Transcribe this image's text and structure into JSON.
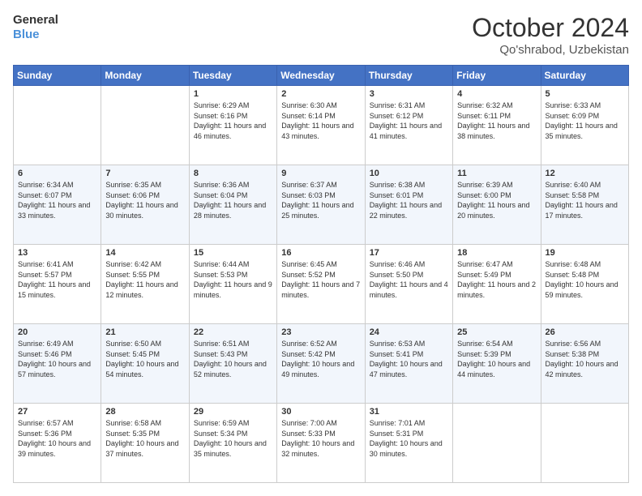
{
  "header": {
    "logo_general": "General",
    "logo_blue": "Blue",
    "month": "October 2024",
    "location": "Qo'shrabod, Uzbekistan"
  },
  "weekdays": [
    "Sunday",
    "Monday",
    "Tuesday",
    "Wednesday",
    "Thursday",
    "Friday",
    "Saturday"
  ],
  "weeks": [
    [
      {
        "day": "",
        "sunrise": "",
        "sunset": "",
        "daylight": ""
      },
      {
        "day": "",
        "sunrise": "",
        "sunset": "",
        "daylight": ""
      },
      {
        "day": "1",
        "sunrise": "Sunrise: 6:29 AM",
        "sunset": "Sunset: 6:16 PM",
        "daylight": "Daylight: 11 hours and 46 minutes."
      },
      {
        "day": "2",
        "sunrise": "Sunrise: 6:30 AM",
        "sunset": "Sunset: 6:14 PM",
        "daylight": "Daylight: 11 hours and 43 minutes."
      },
      {
        "day": "3",
        "sunrise": "Sunrise: 6:31 AM",
        "sunset": "Sunset: 6:12 PM",
        "daylight": "Daylight: 11 hours and 41 minutes."
      },
      {
        "day": "4",
        "sunrise": "Sunrise: 6:32 AM",
        "sunset": "Sunset: 6:11 PM",
        "daylight": "Daylight: 11 hours and 38 minutes."
      },
      {
        "day": "5",
        "sunrise": "Sunrise: 6:33 AM",
        "sunset": "Sunset: 6:09 PM",
        "daylight": "Daylight: 11 hours and 35 minutes."
      }
    ],
    [
      {
        "day": "6",
        "sunrise": "Sunrise: 6:34 AM",
        "sunset": "Sunset: 6:07 PM",
        "daylight": "Daylight: 11 hours and 33 minutes."
      },
      {
        "day": "7",
        "sunrise": "Sunrise: 6:35 AM",
        "sunset": "Sunset: 6:06 PM",
        "daylight": "Daylight: 11 hours and 30 minutes."
      },
      {
        "day": "8",
        "sunrise": "Sunrise: 6:36 AM",
        "sunset": "Sunset: 6:04 PM",
        "daylight": "Daylight: 11 hours and 28 minutes."
      },
      {
        "day": "9",
        "sunrise": "Sunrise: 6:37 AM",
        "sunset": "Sunset: 6:03 PM",
        "daylight": "Daylight: 11 hours and 25 minutes."
      },
      {
        "day": "10",
        "sunrise": "Sunrise: 6:38 AM",
        "sunset": "Sunset: 6:01 PM",
        "daylight": "Daylight: 11 hours and 22 minutes."
      },
      {
        "day": "11",
        "sunrise": "Sunrise: 6:39 AM",
        "sunset": "Sunset: 6:00 PM",
        "daylight": "Daylight: 11 hours and 20 minutes."
      },
      {
        "day": "12",
        "sunrise": "Sunrise: 6:40 AM",
        "sunset": "Sunset: 5:58 PM",
        "daylight": "Daylight: 11 hours and 17 minutes."
      }
    ],
    [
      {
        "day": "13",
        "sunrise": "Sunrise: 6:41 AM",
        "sunset": "Sunset: 5:57 PM",
        "daylight": "Daylight: 11 hours and 15 minutes."
      },
      {
        "day": "14",
        "sunrise": "Sunrise: 6:42 AM",
        "sunset": "Sunset: 5:55 PM",
        "daylight": "Daylight: 11 hours and 12 minutes."
      },
      {
        "day": "15",
        "sunrise": "Sunrise: 6:44 AM",
        "sunset": "Sunset: 5:53 PM",
        "daylight": "Daylight: 11 hours and 9 minutes."
      },
      {
        "day": "16",
        "sunrise": "Sunrise: 6:45 AM",
        "sunset": "Sunset: 5:52 PM",
        "daylight": "Daylight: 11 hours and 7 minutes."
      },
      {
        "day": "17",
        "sunrise": "Sunrise: 6:46 AM",
        "sunset": "Sunset: 5:50 PM",
        "daylight": "Daylight: 11 hours and 4 minutes."
      },
      {
        "day": "18",
        "sunrise": "Sunrise: 6:47 AM",
        "sunset": "Sunset: 5:49 PM",
        "daylight": "Daylight: 11 hours and 2 minutes."
      },
      {
        "day": "19",
        "sunrise": "Sunrise: 6:48 AM",
        "sunset": "Sunset: 5:48 PM",
        "daylight": "Daylight: 10 hours and 59 minutes."
      }
    ],
    [
      {
        "day": "20",
        "sunrise": "Sunrise: 6:49 AM",
        "sunset": "Sunset: 5:46 PM",
        "daylight": "Daylight: 10 hours and 57 minutes."
      },
      {
        "day": "21",
        "sunrise": "Sunrise: 6:50 AM",
        "sunset": "Sunset: 5:45 PM",
        "daylight": "Daylight: 10 hours and 54 minutes."
      },
      {
        "day": "22",
        "sunrise": "Sunrise: 6:51 AM",
        "sunset": "Sunset: 5:43 PM",
        "daylight": "Daylight: 10 hours and 52 minutes."
      },
      {
        "day": "23",
        "sunrise": "Sunrise: 6:52 AM",
        "sunset": "Sunset: 5:42 PM",
        "daylight": "Daylight: 10 hours and 49 minutes."
      },
      {
        "day": "24",
        "sunrise": "Sunrise: 6:53 AM",
        "sunset": "Sunset: 5:41 PM",
        "daylight": "Daylight: 10 hours and 47 minutes."
      },
      {
        "day": "25",
        "sunrise": "Sunrise: 6:54 AM",
        "sunset": "Sunset: 5:39 PM",
        "daylight": "Daylight: 10 hours and 44 minutes."
      },
      {
        "day": "26",
        "sunrise": "Sunrise: 6:56 AM",
        "sunset": "Sunset: 5:38 PM",
        "daylight": "Daylight: 10 hours and 42 minutes."
      }
    ],
    [
      {
        "day": "27",
        "sunrise": "Sunrise: 6:57 AM",
        "sunset": "Sunset: 5:36 PM",
        "daylight": "Daylight: 10 hours and 39 minutes."
      },
      {
        "day": "28",
        "sunrise": "Sunrise: 6:58 AM",
        "sunset": "Sunset: 5:35 PM",
        "daylight": "Daylight: 10 hours and 37 minutes."
      },
      {
        "day": "29",
        "sunrise": "Sunrise: 6:59 AM",
        "sunset": "Sunset: 5:34 PM",
        "daylight": "Daylight: 10 hours and 35 minutes."
      },
      {
        "day": "30",
        "sunrise": "Sunrise: 7:00 AM",
        "sunset": "Sunset: 5:33 PM",
        "daylight": "Daylight: 10 hours and 32 minutes."
      },
      {
        "day": "31",
        "sunrise": "Sunrise: 7:01 AM",
        "sunset": "Sunset: 5:31 PM",
        "daylight": "Daylight: 10 hours and 30 minutes."
      },
      {
        "day": "",
        "sunrise": "",
        "sunset": "",
        "daylight": ""
      },
      {
        "day": "",
        "sunrise": "",
        "sunset": "",
        "daylight": ""
      }
    ]
  ]
}
